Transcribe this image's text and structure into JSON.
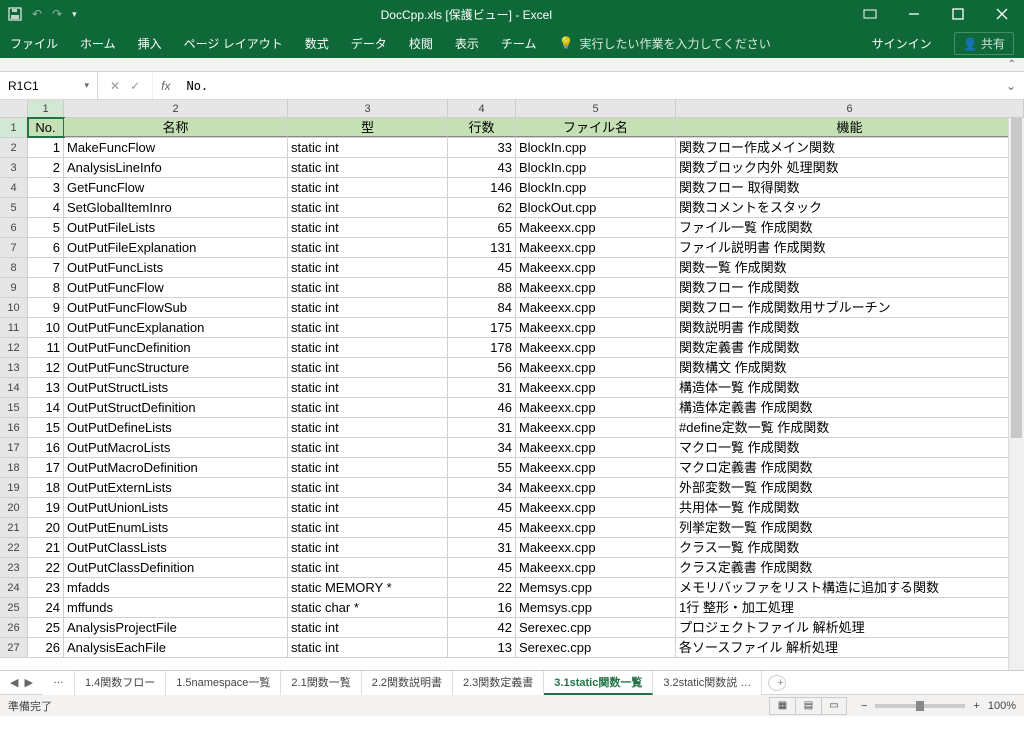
{
  "titlebar": {
    "title": "DocCpp.xls [保護ビュー] - Excel"
  },
  "ribbon": {
    "tabs": [
      "ファイル",
      "ホーム",
      "挿入",
      "ページ レイアウト",
      "数式",
      "データ",
      "校閲",
      "表示",
      "チーム"
    ],
    "tellme": "実行したい作業を入力してください",
    "signin": "サインイン",
    "share": "共有"
  },
  "namebox": "R1C1",
  "formula": "No.",
  "colNumbers": [
    "1",
    "2",
    "3",
    "4",
    "5",
    "6"
  ],
  "headers": {
    "c1": "No.",
    "c2": "名称",
    "c3": "型",
    "c4": "行数",
    "c5": "ファイル名",
    "c6": "機能"
  },
  "rows": [
    {
      "n": "1",
      "name": "MakeFuncFlow",
      "type": "static int",
      "lines": "33",
      "file": "BlockIn.cpp",
      "desc": "関数フロー作成メイン関数"
    },
    {
      "n": "2",
      "name": "AnalysisLineInfo",
      "type": "static int",
      "lines": "43",
      "file": "BlockIn.cpp",
      "desc": "関数ブロック内外 処理関数"
    },
    {
      "n": "3",
      "name": "GetFuncFlow",
      "type": "static int",
      "lines": "146",
      "file": "BlockIn.cpp",
      "desc": "関数フロー 取得関数"
    },
    {
      "n": "4",
      "name": "SetGlobalItemInro",
      "type": "static int",
      "lines": "62",
      "file": "BlockOut.cpp",
      "desc": "関数コメントをスタック"
    },
    {
      "n": "5",
      "name": "OutPutFileLists",
      "type": "static int",
      "lines": "65",
      "file": "Makeexx.cpp",
      "desc": "ファイル一覧 作成関数"
    },
    {
      "n": "6",
      "name": "OutPutFileExplanation",
      "type": "static int",
      "lines": "131",
      "file": "Makeexx.cpp",
      "desc": "ファイル説明書 作成関数"
    },
    {
      "n": "7",
      "name": "OutPutFuncLists",
      "type": "static int",
      "lines": "45",
      "file": "Makeexx.cpp",
      "desc": "関数一覧 作成関数"
    },
    {
      "n": "8",
      "name": "OutPutFuncFlow",
      "type": "static int",
      "lines": "88",
      "file": "Makeexx.cpp",
      "desc": "関数フロー 作成関数"
    },
    {
      "n": "9",
      "name": "OutPutFuncFlowSub",
      "type": "static int",
      "lines": "84",
      "file": "Makeexx.cpp",
      "desc": "関数フロー 作成関数用サブルーチン"
    },
    {
      "n": "10",
      "name": "OutPutFuncExplanation",
      "type": "static int",
      "lines": "175",
      "file": "Makeexx.cpp",
      "desc": "関数説明書 作成関数"
    },
    {
      "n": "11",
      "name": "OutPutFuncDefinition",
      "type": "static int",
      "lines": "178",
      "file": "Makeexx.cpp",
      "desc": "関数定義書 作成関数"
    },
    {
      "n": "12",
      "name": "OutPutFuncStructure",
      "type": "static int",
      "lines": "56",
      "file": "Makeexx.cpp",
      "desc": "関数構文 作成関数"
    },
    {
      "n": "13",
      "name": "OutPutStructLists",
      "type": "static int",
      "lines": "31",
      "file": "Makeexx.cpp",
      "desc": "構造体一覧 作成関数"
    },
    {
      "n": "14",
      "name": "OutPutStructDefinition",
      "type": "static int",
      "lines": "46",
      "file": "Makeexx.cpp",
      "desc": "構造体定義書 作成関数"
    },
    {
      "n": "15",
      "name": "OutPutDefineLists",
      "type": "static int",
      "lines": "31",
      "file": "Makeexx.cpp",
      "desc": "#define定数一覧 作成関数"
    },
    {
      "n": "16",
      "name": "OutPutMacroLists",
      "type": "static int",
      "lines": "34",
      "file": "Makeexx.cpp",
      "desc": "マクロ一覧 作成関数"
    },
    {
      "n": "17",
      "name": "OutPutMacroDefinition",
      "type": "static int",
      "lines": "55",
      "file": "Makeexx.cpp",
      "desc": "マクロ定義書 作成関数"
    },
    {
      "n": "18",
      "name": "OutPutExternLists",
      "type": "static int",
      "lines": "34",
      "file": "Makeexx.cpp",
      "desc": "外部変数一覧 作成関数"
    },
    {
      "n": "19",
      "name": "OutPutUnionLists",
      "type": "static int",
      "lines": "45",
      "file": "Makeexx.cpp",
      "desc": "共用体一覧 作成関数"
    },
    {
      "n": "20",
      "name": "OutPutEnumLists",
      "type": "static int",
      "lines": "45",
      "file": "Makeexx.cpp",
      "desc": "列挙定数一覧 作成関数"
    },
    {
      "n": "21",
      "name": "OutPutClassLists",
      "type": "static int",
      "lines": "31",
      "file": "Makeexx.cpp",
      "desc": "クラス一覧 作成関数"
    },
    {
      "n": "22",
      "name": "OutPutClassDefinition",
      "type": "static int",
      "lines": "45",
      "file": "Makeexx.cpp",
      "desc": "クラス定義書 作成関数"
    },
    {
      "n": "23",
      "name": "mfadds",
      "type": "static MEMORY *",
      "lines": "22",
      "file": "Memsys.cpp",
      "desc": "メモリバッファをリスト構造に追加する関数"
    },
    {
      "n": "24",
      "name": "mffunds",
      "type": "static char *",
      "lines": "16",
      "file": "Memsys.cpp",
      "desc": "1行 整形・加工処理"
    },
    {
      "n": "25",
      "name": "AnalysisProjectFile",
      "type": "static int",
      "lines": "42",
      "file": "Serexec.cpp",
      "desc": "プロジェクトファイル 解析処理"
    },
    {
      "n": "26",
      "name": "AnalysisEachFile",
      "type": "static int",
      "lines": "13",
      "file": "Serexec.cpp",
      "desc": "各ソースファイル 解析処理"
    }
  ],
  "sheetTabs": {
    "overflow": "…",
    "list": [
      "1.4関数フロー",
      "1.5namespace一覧",
      "2.1関数一覧",
      "2.2関数説明書",
      "2.3関数定義書",
      "3.1static関数一覧",
      "3.2static関数説 …"
    ],
    "active": 5
  },
  "status": {
    "ready": "準備完了",
    "zoom": "100%"
  }
}
